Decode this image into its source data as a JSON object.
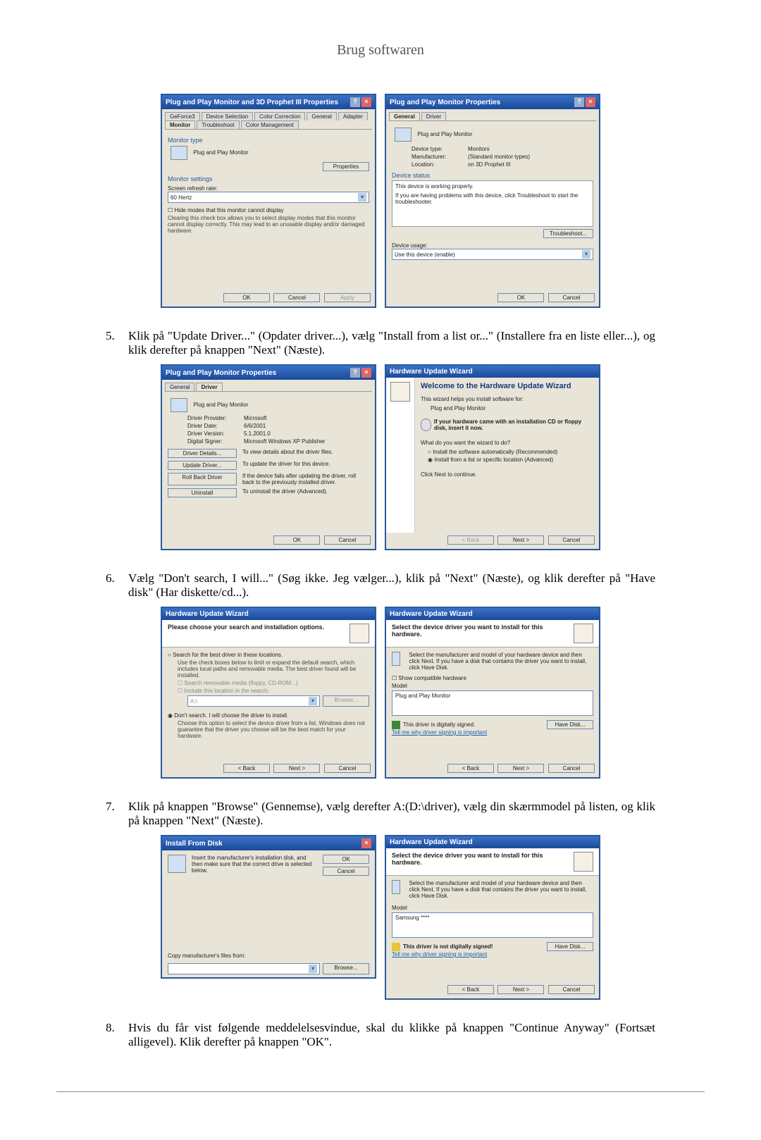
{
  "page_title": "Brug softwaren",
  "steps": {
    "s5": {
      "num": "5.",
      "text": "Klik på \"Update Driver...\" (Opdater driver...), vælg \"Install from a list or...\" (Installere fra en liste eller...), og klik derefter på knappen \"Next\" (Næste)."
    },
    "s6": {
      "num": "6.",
      "text": "Vælg \"Don't search, I will...\" (Søg ikke. Jeg vælger...), klik på \"Next\" (Næste), og klik derefter på \"Have disk\" (Har diskette/cd...)."
    },
    "s7": {
      "num": "7.",
      "text": "Klik på knappen \"Browse\" (Gennemse), vælg derefter A:(D:\\driver), vælg din skærmmodel på listen, og klik på knappen \"Next\" (Næste)."
    },
    "s8": {
      "num": "8.",
      "text": "Hvis du får vist følgende meddelelsesvindue, skal du klikke på knappen \"Continue Anyway\" (Fortsæt alligevel). Klik derefter på knappen \"OK\"."
    }
  },
  "common": {
    "ok": "OK",
    "cancel": "Cancel",
    "apply": "Apply",
    "back": "< Back",
    "next": "Next >",
    "browse": "Browse...",
    "have_disk": "Have Disk..."
  },
  "dlg1": {
    "title": "Plug and Play Monitor and 3D Prophet III Properties",
    "tabs": [
      "GeForce3",
      "Device Selection",
      "Color Correction",
      "General",
      "Adapter",
      "Monitor",
      "Troubleshoot",
      "Color Management"
    ],
    "monitor_type": "Monitor type",
    "monitor_name": "Plug and Play Monitor",
    "properties": "Properties",
    "monitor_settings": "Monitor settings",
    "refresh_label": "Screen refresh rate:",
    "refresh_val": "60 Hertz",
    "hide_modes": "Hide modes that this monitor cannot display",
    "hide_note": "Clearing this check box allows you to select display modes that this monitor cannot display correctly. This may lead to an unusable display and/or damaged hardware."
  },
  "dlg2": {
    "title": "Plug and Play Monitor Properties",
    "tabs": [
      "General",
      "Driver"
    ],
    "name": "Plug and Play Monitor",
    "devtype_k": "Device type:",
    "devtype_v": "Monitors",
    "mfr_k": "Manufacturer:",
    "mfr_v": "(Standard monitor types)",
    "loc_k": "Location:",
    "loc_v": "on 3D Prophet III",
    "status_h": "Device status",
    "status_1": "This device is working properly.",
    "status_2": "If you are having problems with this device, click Troubleshoot to start the troubleshooter.",
    "troubleshoot": "Troubleshoot...",
    "usage_h": "Device usage:",
    "usage_v": "Use this device (enable)"
  },
  "dlg3": {
    "title": "Plug and Play Monitor Properties",
    "tabs": [
      "General",
      "Driver"
    ],
    "name": "Plug and Play Monitor",
    "prov_k": "Driver Provider:",
    "prov_v": "Microsoft",
    "date_k": "Driver Date:",
    "date_v": "6/6/2001",
    "ver_k": "Driver Version:",
    "ver_v": "5.1.2001.0",
    "sign_k": "Digital Signer:",
    "sign_v": "Microsoft Windows XP Publisher",
    "details_btn": "Driver Details...",
    "details_t": "To view details about the driver files.",
    "update_btn": "Update Driver...",
    "update_t": "To update the driver for this device.",
    "rollback_btn": "Roll Back Driver",
    "rollback_t": "If the device fails after updating the driver, roll back to the previously installed driver.",
    "uninstall_btn": "Uninstall",
    "uninstall_t": "To uninstall the driver (Advanced)."
  },
  "dlg4": {
    "title": "Hardware Update Wizard",
    "welcome": "Welcome to the Hardware Update Wizard",
    "line1": "This wizard helps you install software for:",
    "line2": "Plug and Play Monitor",
    "cd_hint": "If your hardware came with an installation CD or floppy disk, insert it now.",
    "q": "What do you want the wizard to do?",
    "opt1": "Install the software automatically (Recommended)",
    "opt2": "Install from a list or specific location (Advanced)",
    "cont": "Click Next to continue."
  },
  "dlg5": {
    "title": "Hardware Update Wizard",
    "head": "Please choose your search and installation options.",
    "opt1": "Search for the best driver in these locations.",
    "opt1_note": "Use the check boxes below to limit or expand the default search, which includes local paths and removable media. The best driver found will be installed.",
    "c1": "Search removable media (floppy, CD-ROM...)",
    "c2": "Include this location in the search:",
    "path": "A:\\",
    "opt2": "Don't search. I will choose the driver to install.",
    "opt2_note": "Choose this option to select the device driver from a list. Windows does not guarantee that the driver you choose will be the best match for your hardware."
  },
  "dlg6": {
    "title": "Hardware Update Wizard",
    "head": "Select the device driver you want to install for this hardware.",
    "note": "Select the manufacturer and model of your hardware device and then click Next. If you have a disk that contains the driver you want to install, click Have Disk.",
    "show_compat": "Show compatible hardware",
    "model": "Model",
    "model_item": "Plug and Play Monitor",
    "signed": "This driver is digitally signed.",
    "tellme": "Tell me why driver signing is important"
  },
  "dlg7": {
    "title": "Install From Disk",
    "msg": "Insert the manufacturer's installation disk, and then make sure that the correct drive is selected below.",
    "copy": "Copy manufacturer's files from:"
  },
  "dlg8": {
    "title": "Hardware Update Wizard",
    "head": "Select the device driver you want to install for this hardware.",
    "note": "Select the manufacturer and model of your hardware device and then click Next. If you have a disk that contains the driver you want to install, click Have Disk.",
    "model": "Model",
    "model_item": "Samsung ****",
    "unsigned": "This driver is not digitally signed!",
    "tellme": "Tell me why driver signing is important"
  }
}
